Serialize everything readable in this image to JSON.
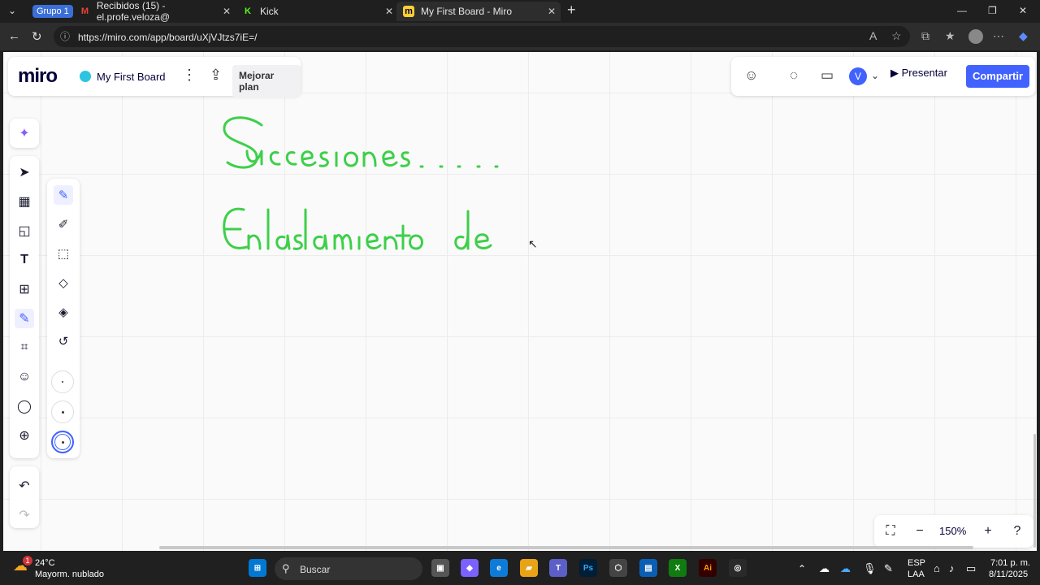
{
  "browser": {
    "group_label": "Grupo 1",
    "tabs": [
      {
        "title": "Recibidos (15) - el.profe.veloza@",
        "icon": "gmail-icon"
      },
      {
        "title": "Kick",
        "icon": "kick-icon"
      },
      {
        "title": "My First Board - Miro",
        "icon": "miro-icon"
      }
    ],
    "url": "https://miro.com/app/board/uXjVJtzs7iE=/"
  },
  "header": {
    "logo": "miro",
    "board_title": "My First Board",
    "upgrade_label": "Mejorar plan",
    "avatar_initial": "V",
    "present_label": "Presentar",
    "share_label": "Compartir"
  },
  "zoom": {
    "level": "150%"
  },
  "canvas": {
    "ink_color": "#3ecf4a",
    "handwriting": [
      "Sucesiones.....",
      "Enlaslamiento de"
    ]
  },
  "taskbar": {
    "weather_temp": "24°C",
    "weather_desc": "Mayorm. nublado",
    "notification_count": "1",
    "search_label": "Buscar",
    "lang_line1": "ESP",
    "lang_line2": "LAA",
    "time": "7:01 p. m.",
    "date": "8/11/2025"
  },
  "colors": {
    "accent": "#4262ff",
    "ink": "#3ecf4a"
  }
}
